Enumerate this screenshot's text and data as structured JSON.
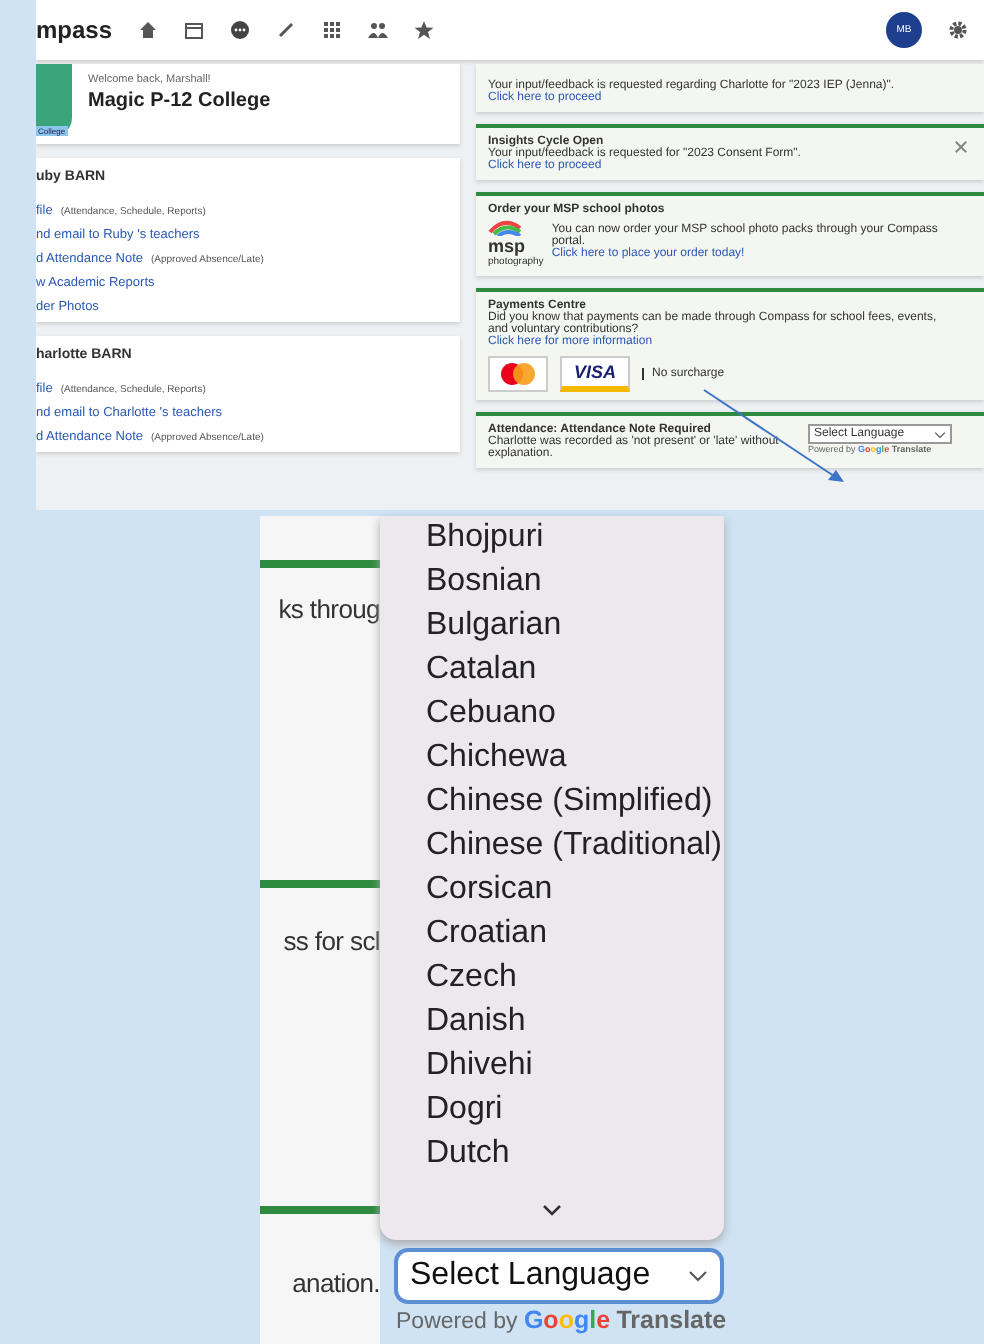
{
  "header": {
    "logo": "mpass",
    "avatar": "MB"
  },
  "school": {
    "welcome": "Welcome back, Marshall!",
    "name": "Magic P-12 College",
    "crest_label": "College"
  },
  "students": [
    {
      "name": "uby BARN",
      "links": [
        {
          "text": "file",
          "note": "(Attendance, Schedule, Reports)"
        },
        {
          "text": "nd email to Ruby 's teachers"
        },
        {
          "text": "d Attendance Note",
          "note": "(Approved Absence/Late)"
        },
        {
          "text": "w Academic Reports"
        },
        {
          "text": "der Photos"
        }
      ]
    },
    {
      "name": "harlotte BARN",
      "links": [
        {
          "text": "file",
          "note": "(Attendance, Schedule, Reports)"
        },
        {
          "text": "nd email to Charlotte 's teachers"
        },
        {
          "text": "d Attendance Note",
          "note": "(Approved Absence/Late)"
        }
      ]
    }
  ],
  "notices": [
    {
      "kind": "text",
      "body": "Your input/feedback is requested regarding Charlotte for \"2023 IEP (Jenna)\".",
      "link": "Click here to proceed",
      "closable": false
    },
    {
      "kind": "text",
      "title": "Insights Cycle Open",
      "body": "Your input/feedback is requested for \"2023 Consent Form\".",
      "link": "Click here to proceed",
      "closable": true
    },
    {
      "kind": "msp",
      "title": "Order your MSP school photos",
      "body": "You can now order your MSP school photo packs through your Compass portal.",
      "logo": "msp",
      "logo_sub": "photography",
      "link": "Click here to place your order today!",
      "closable": false
    },
    {
      "kind": "payments",
      "title": "Payments Centre",
      "body": "Did you know that payments can be made through Compass for school fees, events, and voluntary contributions?",
      "link": "Click here for more information",
      "card": "VISA",
      "note": "No surcharge",
      "closable": false
    },
    {
      "kind": "attendance",
      "title": "Attendance: Attendance Note Required",
      "body": "Charlotte was recorded as 'not present' or 'late' without explanation.",
      "closable": false
    }
  ],
  "translate_small": {
    "select": "Select Language",
    "powered": "Powered by",
    "brand": "Google",
    "product": "Translate"
  },
  "zoom": {
    "fragments": [
      "ks throug",
      "ss for scl",
      "anation."
    ],
    "languages": [
      "Bhojpuri",
      "Bosnian",
      "Bulgarian",
      "Catalan",
      "Cebuano",
      "Chichewa",
      "Chinese (Simplified)",
      "Chinese (Traditional)",
      "Corsican",
      "Croatian",
      "Czech",
      "Danish",
      "Dhivehi",
      "Dogri",
      "Dutch"
    ],
    "select": "Select Language",
    "powered": "Powered by",
    "brand": "Google",
    "product": "Translate"
  }
}
